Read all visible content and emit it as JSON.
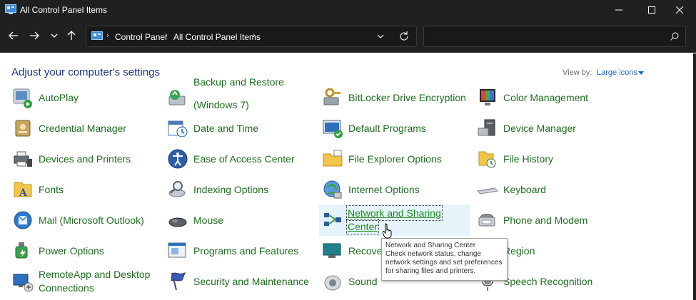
{
  "window": {
    "title": "All Control Panel Items"
  },
  "nav": {
    "breadcrumbs": [
      "Control Panel",
      "All Control Panel Items"
    ],
    "search_placeholder": ""
  },
  "header": {
    "heading": "Adjust your computer's settings",
    "view_by_label": "View by:",
    "view_by_value": "Large icons"
  },
  "items": [
    {
      "label": "AutoPlay",
      "icon": "autoplay-icon"
    },
    {
      "label": "Backup and Restore (Windows 7)",
      "line1": "Backup and Restore",
      "line2": "(Windows 7)",
      "icon": "backup-icon"
    },
    {
      "label": "BitLocker Drive Encryption",
      "icon": "bitlocker-icon"
    },
    {
      "label": "Color Management",
      "icon": "color-management-icon"
    },
    {
      "label": "Credential Manager",
      "icon": "credential-manager-icon"
    },
    {
      "label": "Date and Time",
      "icon": "calendar-clock-icon"
    },
    {
      "label": "Default Programs",
      "icon": "default-programs-icon"
    },
    {
      "label": "Device Manager",
      "icon": "device-manager-icon"
    },
    {
      "label": "Devices and Printers",
      "icon": "printer-icon"
    },
    {
      "label": "Ease of Access Center",
      "icon": "ease-of-access-icon"
    },
    {
      "label": "File Explorer Options",
      "icon": "folder-options-icon"
    },
    {
      "label": "File History",
      "icon": "file-history-icon"
    },
    {
      "label": "Fonts",
      "icon": "fonts-icon"
    },
    {
      "label": "Indexing Options",
      "icon": "indexing-icon"
    },
    {
      "label": "Internet Options",
      "icon": "internet-globe-icon"
    },
    {
      "label": "Keyboard",
      "icon": "keyboard-icon"
    },
    {
      "label": "Mail (Microsoft Outlook)",
      "icon": "mail-icon"
    },
    {
      "label": "Mouse",
      "icon": "mouse-icon"
    },
    {
      "label": "Network and Sharing Center",
      "line1": "Network and Sharing",
      "line2": "Center",
      "icon": "network-icon"
    },
    {
      "label": "Phone and Modem",
      "icon": "phone-modem-icon"
    },
    {
      "label": "Power Options",
      "icon": "power-options-icon"
    },
    {
      "label": "Programs and Features",
      "icon": "programs-features-icon"
    },
    {
      "label": "Recover",
      "icon": "recovery-icon"
    },
    {
      "label": "Region",
      "icon": "region-icon"
    },
    {
      "label": "RemoteApp and Desktop Connections",
      "line1": "RemoteApp and Desktop",
      "line2": "Connections",
      "icon": "remoteapp-icon"
    },
    {
      "label": "Security and Maintenance",
      "icon": "security-flag-icon"
    },
    {
      "label": "Sound",
      "icon": "speaker-icon"
    },
    {
      "label": "Speech Recognition",
      "icon": "microphone-icon"
    }
  ],
  "tooltip": {
    "lines": [
      "Network and Sharing Center",
      "Check network status, change",
      "network settings and set preferences",
      "for sharing files and printers."
    ]
  },
  "colors": {
    "titlebar": "#202020",
    "link_green": "#1e6e1e",
    "heading_blue": "#1e3287",
    "hover_bg": "#e5f3fb"
  }
}
